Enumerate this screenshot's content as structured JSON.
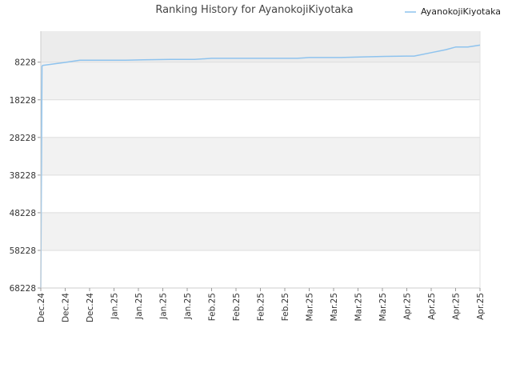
{
  "chart_data": {
    "type": "line",
    "title": "Ranking History for AyanokojiKiyotaka",
    "xlabel": "",
    "ylabel": "",
    "y_reversed": true,
    "ylim": [
      68228,
      0
    ],
    "y_ticks": [
      8228,
      18228,
      28228,
      38228,
      48228,
      58228,
      68228
    ],
    "y_tick_labels": [
      "8228",
      "18228",
      "28228",
      "38228",
      "48228",
      "58228",
      "68228"
    ],
    "x_tick_labels": [
      "Dec.24",
      "Dec.24",
      "Dec.24",
      "Jan.25",
      "Jan.25",
      "Jan.25",
      "Jan.25",
      "Feb.25",
      "Feb.25",
      "Feb.25",
      "Feb.25",
      "Mar.25",
      "Mar.25",
      "Mar.25",
      "Mar.25",
      "Apr.25",
      "Apr.25",
      "Apr.25",
      "Apr.25"
    ],
    "grid": true,
    "banded_background": true,
    "legend_position": "top-right",
    "colors": {
      "line": "#8ec3ee",
      "band": "#f2f2f2",
      "band_top": "#ececec",
      "grid": "#dddddd"
    },
    "series": [
      {
        "name": "AyanokojiKiyotaka",
        "x": [
          0,
          0.05,
          0.08,
          1.0,
          1.6,
          2.5,
          3.5,
          4.2,
          5.3,
          6.3,
          7.0,
          8.4,
          9.5,
          10.5,
          11.0,
          12.3,
          13.4,
          14.1,
          15.0,
          15.3,
          16.0,
          16.6,
          17.0,
          17.5,
          18.0
        ],
        "y": [
          68228,
          9300,
          9100,
          8300,
          7700,
          7700,
          7700,
          7600,
          7500,
          7500,
          7200,
          7200,
          7200,
          7200,
          7000,
          7000,
          6800,
          6700,
          6600,
          6600,
          5700,
          4900,
          4200,
          4200,
          3700
        ]
      }
    ]
  }
}
